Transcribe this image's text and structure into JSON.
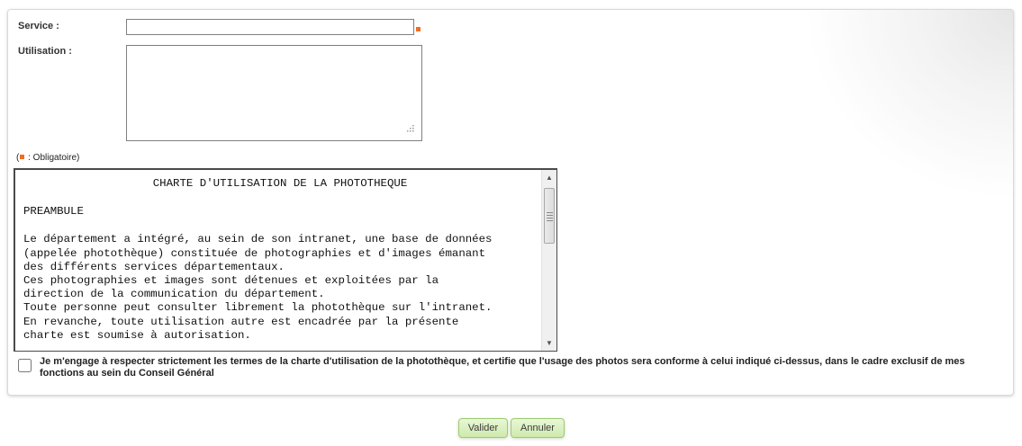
{
  "form": {
    "service_label": "Service :",
    "service_value": "",
    "usage_label": "Utilisation :",
    "usage_value": "",
    "required_legend_prefix": "(",
    "required_legend_suffix": " : Obligatoire)",
    "required_color": "#f06e1e"
  },
  "charter": {
    "title": "CHARTE D'UTILISATION DE LA PHOTOTHEQUE",
    "heading": "PREAMBULE",
    "lines": [
      "Le département a intégré, au sein de son intranet, une base de données",
      "(appelée photothèque) constituée de photographies et d'images émanant",
      "des différents services départementaux.",
      "Ces photographies et images sont détenues et exploitées par la",
      "direction de la communication du département.",
      "Toute personne peut consulter librement la photothèque sur l'intranet.",
      "En revanche, toute utilisation autre est encadrée par la présente",
      "charte est soumise à autorisation."
    ]
  },
  "agreement": {
    "checked": false,
    "text": "Je m'engage à respecter strictement les termes de la charte d'utilisation de la photothèque, et certifie que l'usage des photos sera conforme à celui indiqué ci-dessus, dans le cadre exclusif de mes fonctions au sein du Conseil Général"
  },
  "actions": {
    "submit_label": "Valider",
    "cancel_label": "Annuler",
    "button_color": "#cfe9ad"
  }
}
